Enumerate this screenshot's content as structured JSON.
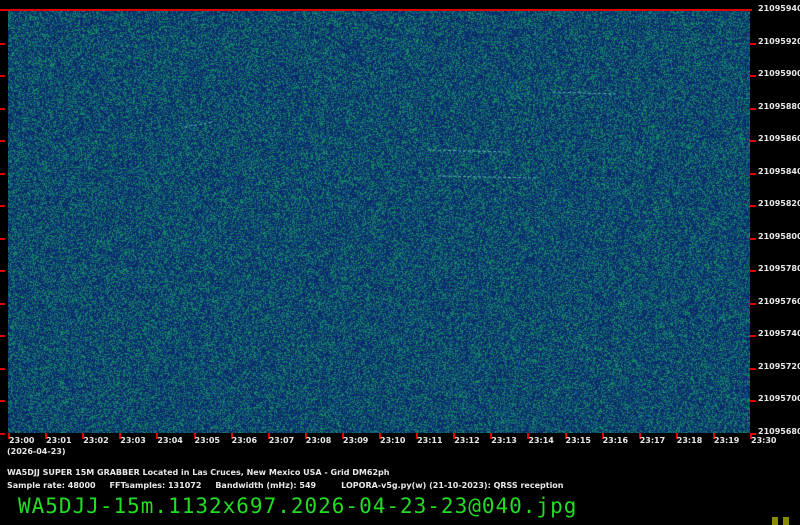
{
  "freq_labels": [
    "21095940",
    "21095920",
    "21095900",
    "21095880",
    "21095860",
    "21095840",
    "21095820",
    "21095800",
    "21095780",
    "21095760",
    "21095740",
    "21095720",
    "21095700",
    "21095680"
  ],
  "time_labels": [
    "23:00",
    "23:01",
    "23:02",
    "23:03",
    "23:04",
    "23:05",
    "23:06",
    "23:07",
    "23:08",
    "23:09",
    "23:10",
    "23:11",
    "23:12",
    "23:13",
    "23:14",
    "23:15",
    "23:16",
    "23:17",
    "23:18",
    "23:19",
    "23:30"
  ],
  "date_label": "(2026-04-23)",
  "station_line": "WA5DJJ SUPER 15M GRABBER Located in Las Cruces, New Mexico USA - Grid DM62ph",
  "params": {
    "sample_rate": "Sample rate: 48000",
    "fft": "FFTsamples: 131072",
    "bandwidth": "Bandwidth (mHz): 549",
    "software": "LOPORA-v5g.py(w) (21-10-2023): QRSS reception"
  },
  "filename": "WA5DJJ-15m.1132x697.2026-04-23-23@040.jpg",
  "colors": {
    "background": "#0b2a6a",
    "noise": "#1f8a6a",
    "tick": "#e00000",
    "filename": "#22dd22"
  }
}
